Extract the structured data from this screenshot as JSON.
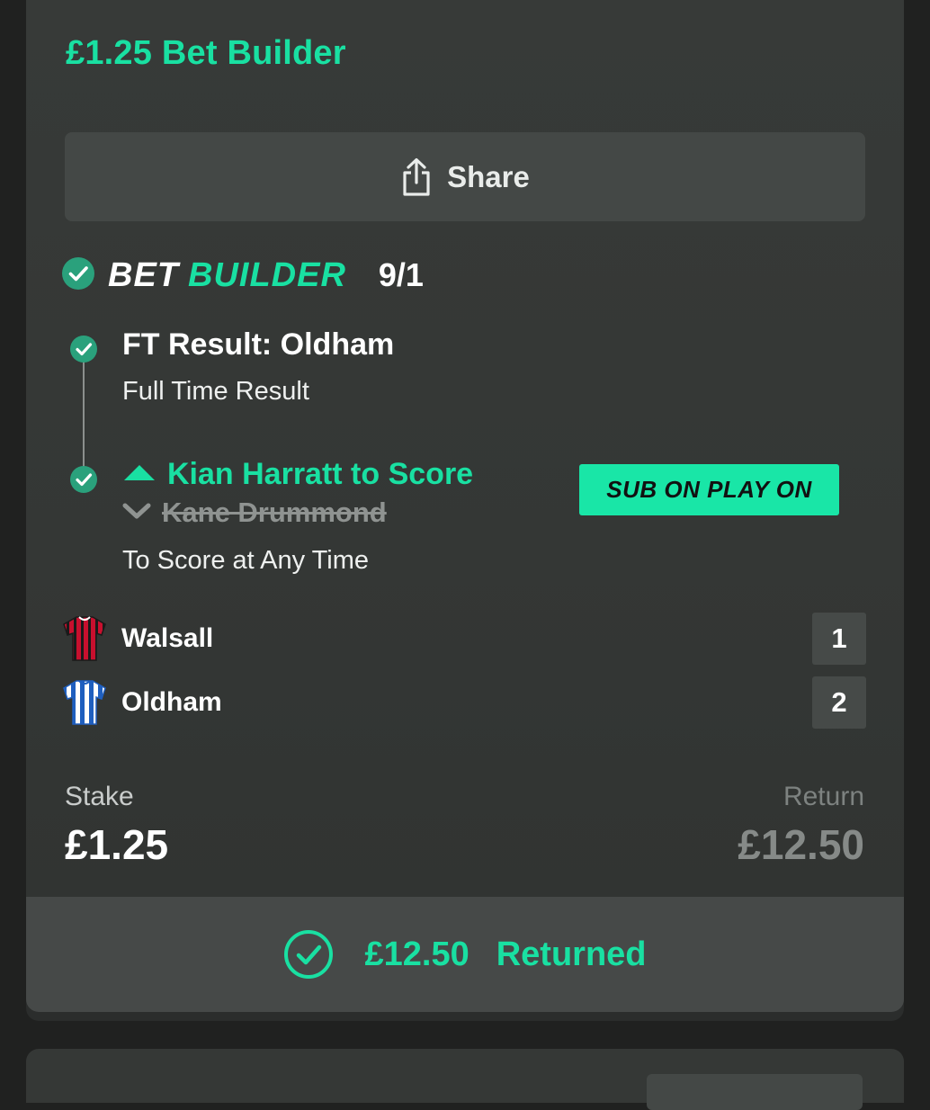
{
  "header": {
    "title": "£1.25 Bet Builder"
  },
  "share": {
    "label": "Share"
  },
  "bet_builder": {
    "word1": "BET",
    "word2": "BUILDER",
    "odds": "9/1"
  },
  "legs": [
    {
      "title": "FT Result: Oldham",
      "subtitle": "Full Time Result"
    },
    {
      "sub_in": "Kian Harratt to Score",
      "sub_out": "Kane Drummond",
      "subtitle": "To Score at Any Time",
      "badge": "SUB ON PLAY ON"
    }
  ],
  "teams": [
    {
      "name": "Walsall",
      "score": "1",
      "kit_colors": [
        "#c8102e",
        "#111111"
      ]
    },
    {
      "name": "Oldham",
      "score": "2",
      "kit_colors": [
        "#1f5fbf",
        "#ffffff"
      ]
    }
  ],
  "stake": {
    "label": "Stake",
    "value": "£1.25"
  },
  "return": {
    "label": "Return",
    "value": "£12.50"
  },
  "returned": {
    "amount": "£12.50",
    "label": "Returned"
  },
  "icons": {
    "share": "share-icon",
    "check": "check-circle-icon",
    "arrow_up": "arrow-up-icon",
    "arrow_down": "arrow-down-icon",
    "kit": "football-shirt-icon"
  },
  "colors": {
    "accent": "#19e0a2",
    "card_bg": "#373a38",
    "page_bg": "#202120"
  }
}
